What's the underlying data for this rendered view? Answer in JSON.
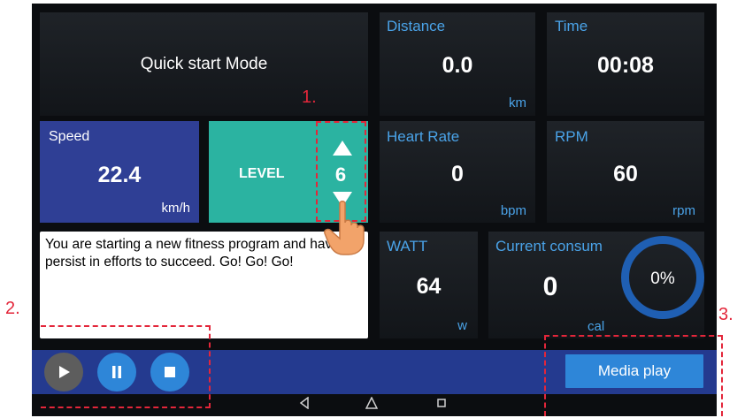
{
  "quick_start": {
    "label": "Quick start Mode"
  },
  "tiles": {
    "distance": {
      "label": "Distance",
      "value": "0.0",
      "unit": "km"
    },
    "time": {
      "label": "Time",
      "value": "00:08"
    },
    "heart_rate": {
      "label": "Heart Rate",
      "value": "0",
      "unit": "bpm"
    },
    "rpm": {
      "label": "RPM",
      "value": "60",
      "unit": "rpm"
    },
    "watt": {
      "label": "WATT",
      "value": "64",
      "unit": "w"
    },
    "current": {
      "label": "Current consum",
      "value": "0",
      "unit": "cal",
      "ring_percent": "0%",
      "progress": 0
    }
  },
  "speed": {
    "label": "Speed",
    "value": "22.4",
    "unit": "km/h"
  },
  "level": {
    "label": "LEVEL",
    "value": "6"
  },
  "message": {
    "text": "You are starting a new fitness program and have to persist in efforts to succeed. Go! Go! Go!"
  },
  "media": {
    "label": "Media play"
  },
  "callouts": {
    "one": "1.",
    "two": "2.",
    "three": "3."
  },
  "icons": {
    "play": "play-icon",
    "pause": "pause-icon",
    "stop": "stop-icon",
    "nav_back": "nav-back-icon",
    "nav_home": "nav-home-icon",
    "nav_recent": "nav-recent-icon",
    "hand": "hand-pointer-icon"
  },
  "colors": {
    "accent_blue": "#4aa3e8",
    "speed_bg": "#2f3f95",
    "level_bg": "#2bb3a1",
    "bar_bg": "#243a8f",
    "media_btn": "#2e86d8",
    "annotation_red": "#e3263a"
  }
}
